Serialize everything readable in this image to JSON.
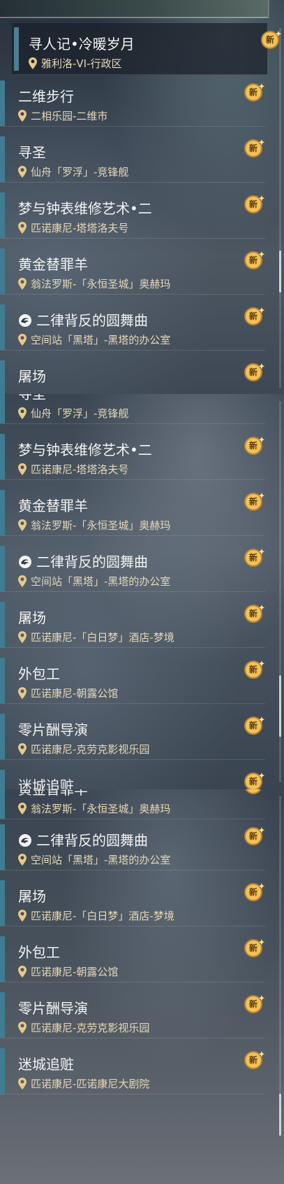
{
  "screens": [
    {
      "items": [
        {
          "title": "寻人记•冷暖岁月",
          "location": "雅利洛-VI-行政区",
          "badge": "新",
          "selected": true
        },
        {
          "title": "二维步行",
          "location": "二相乐园-二维市",
          "badge": "新"
        },
        {
          "title": "寻圣",
          "location": "仙舟「罗浮」-竞锋舰",
          "badge": "新"
        },
        {
          "title": "梦与钟表维修艺术•二",
          "location": "匹诺康尼-塔塔洛夫号",
          "badge": "新"
        },
        {
          "title": "黄金替罪羊",
          "location": "翁法罗斯-「永恒圣城」奥赫玛",
          "badge": "新"
        },
        {
          "title": "二律背反的圆舞曲",
          "location": "空间站「黑塔」-黑塔的办公室",
          "badge": "新",
          "icon": "swirl-icon"
        },
        {
          "title": "屠场",
          "location": "",
          "badge": "新"
        }
      ]
    },
    {
      "items": [
        {
          "title": "寻圣",
          "location": "仙舟「罗浮」-竞锋舰",
          "badge": "新"
        },
        {
          "title": "梦与钟表维修艺术•二",
          "location": "匹诺康尼-塔塔洛夫号",
          "badge": "新"
        },
        {
          "title": "黄金替罪羊",
          "location": "翁法罗斯-「永恒圣城」奥赫玛",
          "badge": "新"
        },
        {
          "title": "二律背反的圆舞曲",
          "location": "空间站「黑塔」-黑塔的办公室",
          "badge": "新",
          "icon": "swirl-icon"
        },
        {
          "title": "屠场",
          "location": "匹诺康尼-「白日梦」酒店-梦境",
          "badge": "新"
        },
        {
          "title": "外包工",
          "location": "匹诺康尼-朝露公馆",
          "badge": "新"
        },
        {
          "title": "零片酬导演",
          "location": "匹诺康尼-克劳克影视乐园",
          "badge": "新"
        },
        {
          "title": "迷城追赃",
          "location": "",
          "badge": "新"
        }
      ]
    },
    {
      "items": [
        {
          "title": "黄金替罪羊",
          "location": "翁法罗斯-「永恒圣城」奥赫玛",
          "badge": "新"
        },
        {
          "title": "二律背反的圆舞曲",
          "location": "空间站「黑塔」-黑塔的办公室",
          "badge": "新",
          "icon": "swirl-icon"
        },
        {
          "title": "屠场",
          "location": "匹诺康尼-「白日梦」酒店-梦境",
          "badge": "新"
        },
        {
          "title": "外包工",
          "location": "匹诺康尼-朝露公馆",
          "badge": "新"
        },
        {
          "title": "零片酬导演",
          "location": "匹诺康尼-克劳克影视乐园",
          "badge": "新"
        },
        {
          "title": "迷城追赃",
          "location": "匹诺康尼-匹诺康尼大剧院",
          "badge": "新"
        }
      ]
    }
  ],
  "colors": {
    "accent": "#3e7d92",
    "title": "#f3f3f3",
    "location": "#e7d8b6",
    "badge": "#e8b34a"
  }
}
